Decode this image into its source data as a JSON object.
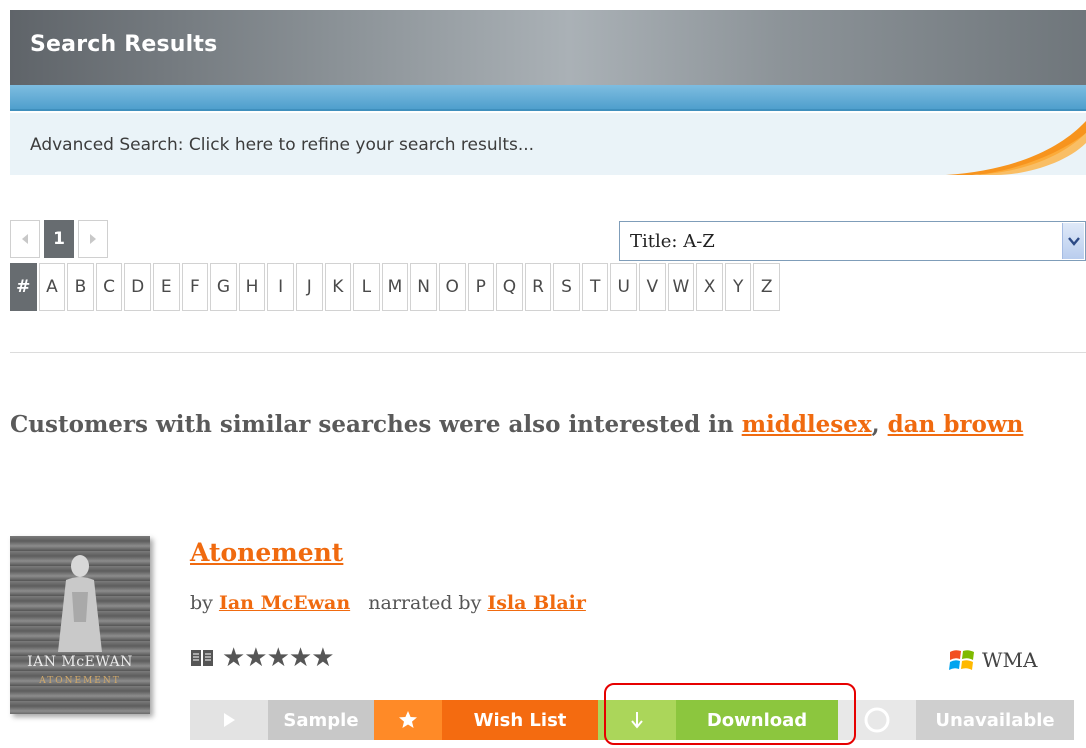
{
  "header": {
    "title": "Search Results"
  },
  "advanced_search": {
    "text": "Advanced Search: Click here to refine your search results..."
  },
  "pager": {
    "prev_icon": "chevron-left-icon",
    "current_page": "1",
    "next_icon": "chevron-right-icon"
  },
  "sort": {
    "selected": "Title: A-Z",
    "arrow_icon": "chevron-down-icon"
  },
  "alphabet": [
    "#",
    "A",
    "B",
    "C",
    "D",
    "E",
    "F",
    "G",
    "H",
    "I",
    "J",
    "K",
    "L",
    "M",
    "N",
    "O",
    "P",
    "Q",
    "R",
    "S",
    "T",
    "U",
    "V",
    "W",
    "X",
    "Y",
    "Z"
  ],
  "suggestions": {
    "prefix": "Customers with similar searches were also interested in ",
    "terms": [
      "middlesex",
      "dan brown"
    ],
    "separator": ", "
  },
  "result": {
    "cover": {
      "author": "IAN McEWAN",
      "title": "ATONEMENT"
    },
    "title": "Atonement",
    "by_label": "by ",
    "author": "Ian McEwan",
    "narrated_label": "narrated by ",
    "narrator": "Isla Blair",
    "rating_stars": 5,
    "stars_text": "★★★★★",
    "format": "WMA",
    "actions": {
      "sample": "Sample",
      "wish_list": "Wish List",
      "download": "Download",
      "unavailable": "Unavailable"
    }
  },
  "colors": {
    "accent_orange": "#f06a0f",
    "download_green": "#8cc63e",
    "highlight_red": "#e60000",
    "header_gray": "#8a9196"
  }
}
